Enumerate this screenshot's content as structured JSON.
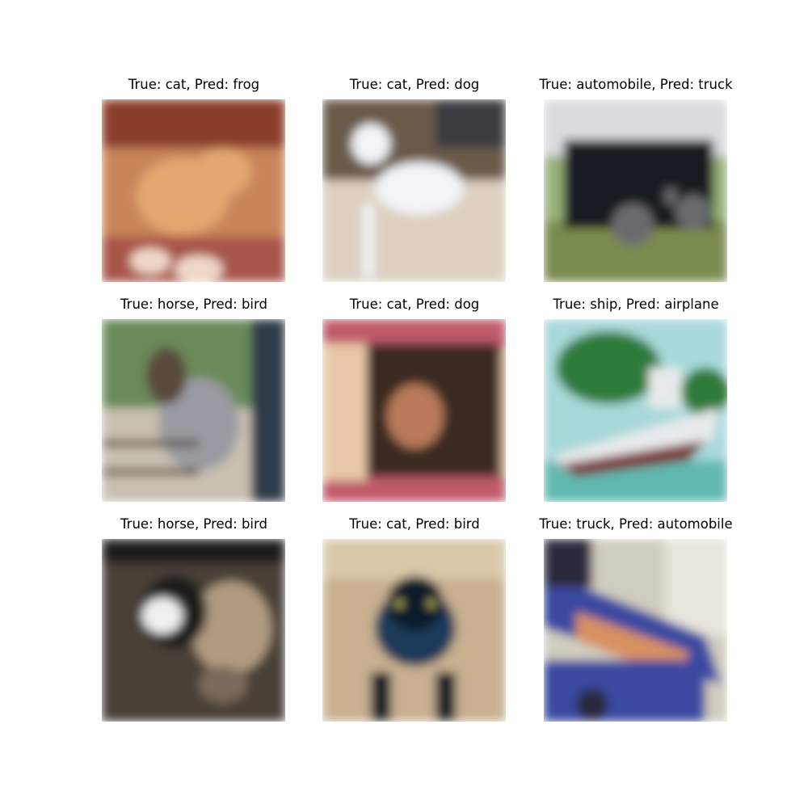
{
  "figure": {
    "panels": [
      {
        "title": "True: cat, Pred: frog",
        "true_label": "cat",
        "pred_label": "frog",
        "image": "orange-cat-on-checkered-cloth",
        "palette": {
          "bg": "#c8855a",
          "a": "#e3a770",
          "b": "#a8544a",
          "c": "#f0d8c8",
          "d": "#8a3c2c"
        }
      },
      {
        "title": "True: cat, Pred: dog",
        "true_label": "cat",
        "pred_label": "dog",
        "image": "white-cat-on-floor",
        "palette": {
          "bg": "#c8b8a0",
          "a": "#f2f4f8",
          "b": "#6a5a4a",
          "c": "#dcd0c0",
          "d": "#3a3a40"
        }
      },
      {
        "title": "True: automobile, Pred: truck",
        "true_label": "automobile",
        "pred_label": "truck",
        "image": "black-suv-on-driveway",
        "palette": {
          "bg": "#9ab07a",
          "a": "#161a22",
          "b": "#d8dce0",
          "c": "#7a8c50",
          "d": "#6a6a6e"
        }
      },
      {
        "title": "True: horse, Pred: bird",
        "true_label": "horse",
        "pred_label": "bird",
        "image": "grey-horse-with-rider-at-fence",
        "palette": {
          "bg": "#6a8a5a",
          "a": "#9a9aa2",
          "b": "#5a4a3e",
          "c": "#c8c0b0",
          "d": "#2e3a4a"
        }
      },
      {
        "title": "True: cat, Pred: dog",
        "true_label": "cat",
        "pred_label": "dog",
        "image": "fluffy-brown-cat-in-doorway",
        "palette": {
          "bg": "#c8a888",
          "a": "#b87a5a",
          "b": "#3a2a20",
          "c": "#c05a6a",
          "d": "#e8c8a8"
        }
      },
      {
        "title": "True: ship, Pred: airplane",
        "true_label": "ship",
        "pred_label": "airplane",
        "image": "white-boat-on-water",
        "palette": {
          "bg": "#a8d8d8",
          "a": "#2e7a3a",
          "b": "#e8eaec",
          "c": "#7a3a3a",
          "d": "#60b8b0"
        }
      },
      {
        "title": "True: horse, Pred: bird",
        "true_label": "horse",
        "pred_label": "bird",
        "image": "horse-and-rider-closeup",
        "palette": {
          "bg": "#4a4038",
          "a": "#b09a80",
          "b": "#1a1a1e",
          "c": "#f0f0f0",
          "d": "#7a6a5a"
        }
      },
      {
        "title": "True: cat, Pred: bird",
        "true_label": "cat",
        "pred_label": "bird",
        "image": "black-cat-walking",
        "palette": {
          "bg": "#c8b090",
          "a": "#0e1a2a",
          "b": "#1e3a5a",
          "c": "#d8c8a8",
          "d": "#e8e070"
        }
      },
      {
        "title": "True: truck, Pred: automobile",
        "true_label": "truck",
        "pred_label": "automobile",
        "image": "blue-dump-truck",
        "palette": {
          "bg": "#d0ccc0",
          "a": "#3a4aa0",
          "b": "#d89060",
          "c": "#e8e4dc",
          "d": "#2a2a3a"
        }
      }
    ]
  }
}
